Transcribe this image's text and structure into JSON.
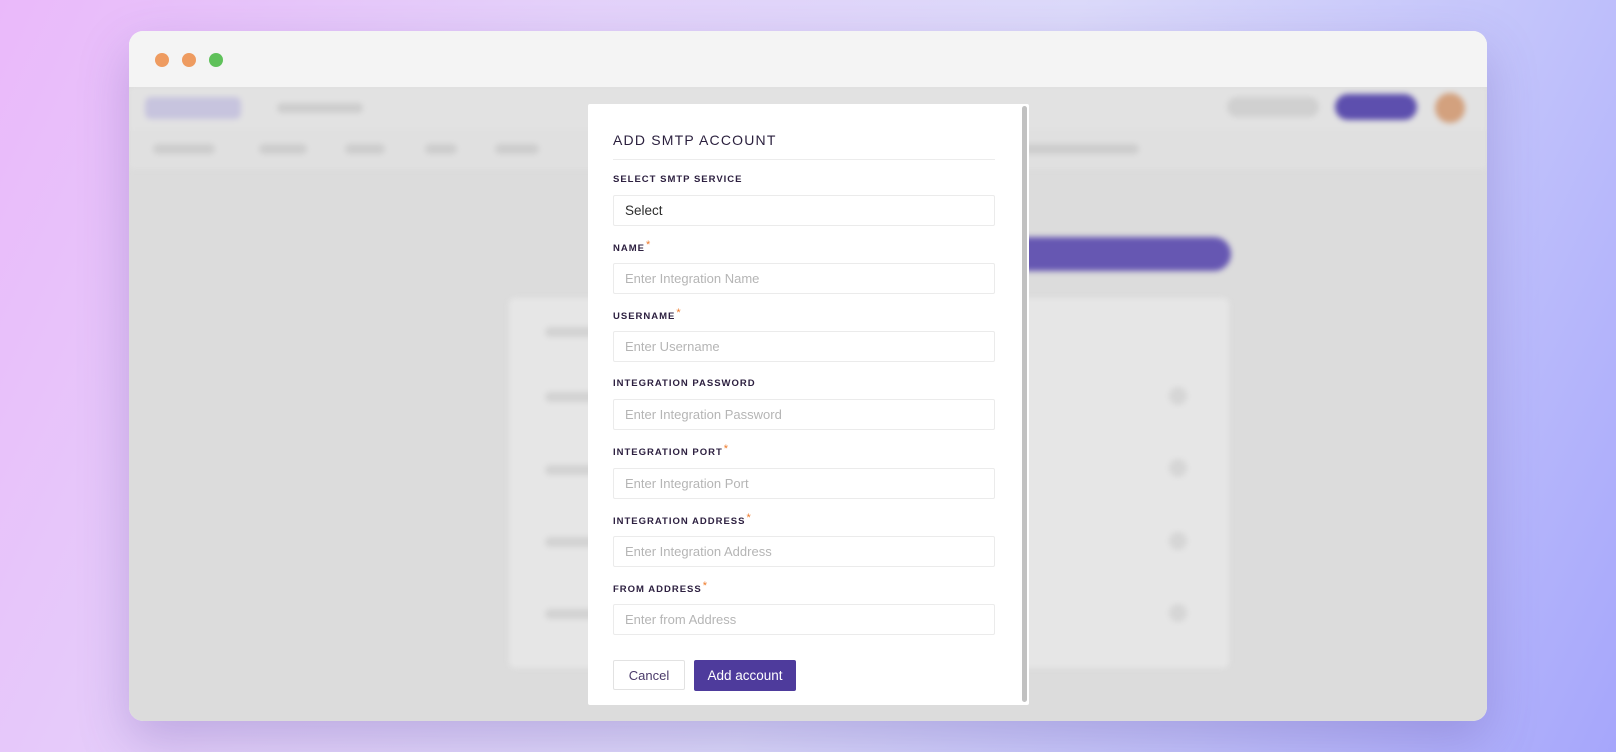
{
  "modal": {
    "title": "ADD SMTP ACCOUNT",
    "required_mark": "*",
    "fields": {
      "service": {
        "label": "SELECT SMTP SERVICE",
        "value": "Select"
      },
      "name": {
        "label": "NAME",
        "placeholder": "Enter Integration Name"
      },
      "username": {
        "label": "USERNAME",
        "placeholder": "Enter Username"
      },
      "password": {
        "label": "INTEGRATION PASSWORD",
        "placeholder": "Enter Integration Password"
      },
      "port": {
        "label": "INTEGRATION PORT",
        "placeholder": "Enter Integration Port"
      },
      "address": {
        "label": "INTEGRATION ADDRESS",
        "placeholder": "Enter Integration Address"
      },
      "from_address": {
        "label": "FROM ADDRESS",
        "placeholder": "Enter from Address"
      }
    },
    "buttons": {
      "cancel": "Cancel",
      "add": "Add account"
    }
  },
  "colors": {
    "primary": "#4e3b9c",
    "required": "#ee7a2a"
  }
}
